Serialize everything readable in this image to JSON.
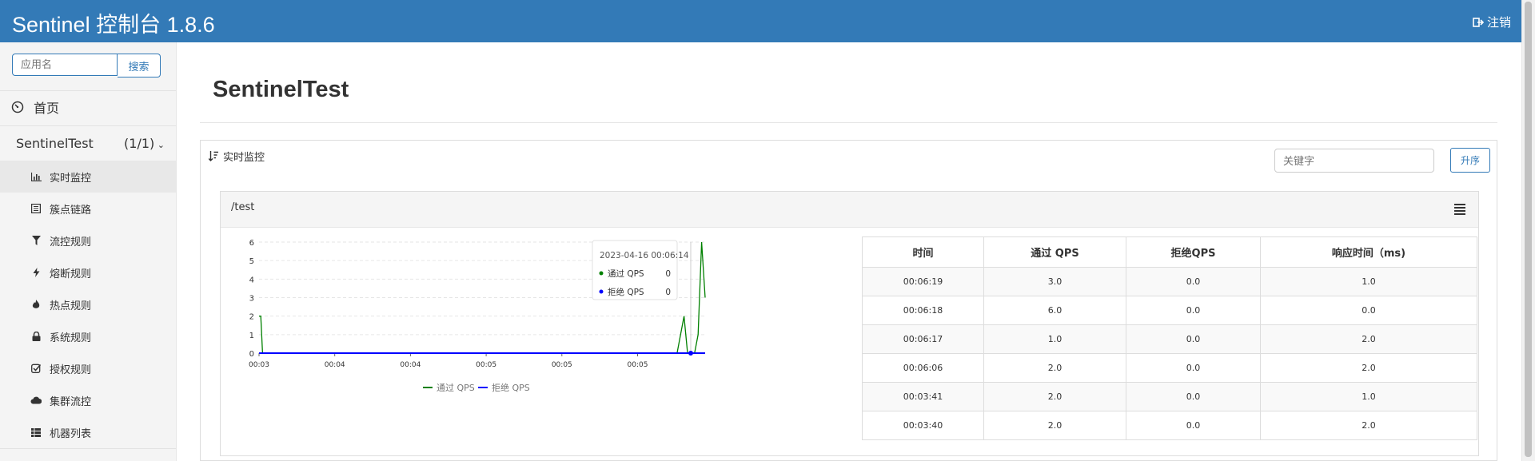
{
  "header": {
    "title": "Sentinel 控制台 1.8.6",
    "logout_label": "注销"
  },
  "sidebar": {
    "search_placeholder": "应用名",
    "search_button": "搜索",
    "home_label": "首页",
    "app_name": "SentinelTest",
    "app_count": "(1/1)",
    "menu": [
      {
        "label": "实时监控",
        "icon": "bar-chart-icon",
        "active": true
      },
      {
        "label": "簇点链路",
        "icon": "list-icon"
      },
      {
        "label": "流控规则",
        "icon": "filter-icon"
      },
      {
        "label": "熔断规则",
        "icon": "flash-icon"
      },
      {
        "label": "热点规则",
        "icon": "fire-icon"
      },
      {
        "label": "系统规则",
        "icon": "lock-icon"
      },
      {
        "label": "授权规则",
        "icon": "check-icon"
      },
      {
        "label": "集群流控",
        "icon": "cloud-icon"
      },
      {
        "label": "机器列表",
        "icon": "grid-icon"
      }
    ]
  },
  "main": {
    "page_title": "SentinelTest",
    "panel_title": "实时监控",
    "keyword_placeholder": "关键字",
    "sort_button": "升序",
    "resource": {
      "name": "/test",
      "table": {
        "headers": [
          "时间",
          "通过 QPS",
          "拒绝QPS",
          "响应时间（ms)"
        ],
        "rows": [
          [
            "00:06:19",
            "3.0",
            "0.0",
            "1.0"
          ],
          [
            "00:06:18",
            "6.0",
            "0.0",
            "0.0"
          ],
          [
            "00:06:17",
            "1.0",
            "0.0",
            "2.0"
          ],
          [
            "00:06:06",
            "2.0",
            "0.0",
            "2.0"
          ],
          [
            "00:03:41",
            "2.0",
            "0.0",
            "1.0"
          ],
          [
            "00:03:40",
            "2.0",
            "0.0",
            "2.0"
          ]
        ]
      },
      "tooltip": {
        "time": "2023-04-16 00:06:14",
        "rows": [
          {
            "label": "通过 QPS",
            "value": "0",
            "color": "#008000"
          },
          {
            "label": "拒绝 QPS",
            "value": "0",
            "color": "#0000ff"
          }
        ]
      }
    }
  },
  "chart_data": {
    "type": "line",
    "ylim": [
      0,
      6
    ],
    "y_ticks": [
      "0",
      "1",
      "2",
      "3",
      "4",
      "5",
      "6"
    ],
    "x_tick_labels": [
      "00:03",
      "00:04",
      "00:04",
      "00:05",
      "00:05",
      "00:05"
    ],
    "legend": [
      "通过 QPS",
      "拒绝 QPS"
    ],
    "legend_position": "bottom-center",
    "grid": true,
    "series": [
      {
        "name": "通过 QPS",
        "color": "#008000",
        "x": [
          0,
          0.5,
          1,
          10,
          60,
          115,
          119,
          121,
          122,
          123,
          124,
          125,
          126,
          127
        ],
        "y": [
          2,
          2,
          0,
          0,
          0,
          0,
          0,
          2,
          0,
          0,
          0,
          1,
          6,
          3
        ]
      },
      {
        "name": "拒绝 QPS",
        "color": "#0000ff",
        "x": [
          0,
          127
        ],
        "y": [
          0,
          0
        ]
      }
    ]
  }
}
